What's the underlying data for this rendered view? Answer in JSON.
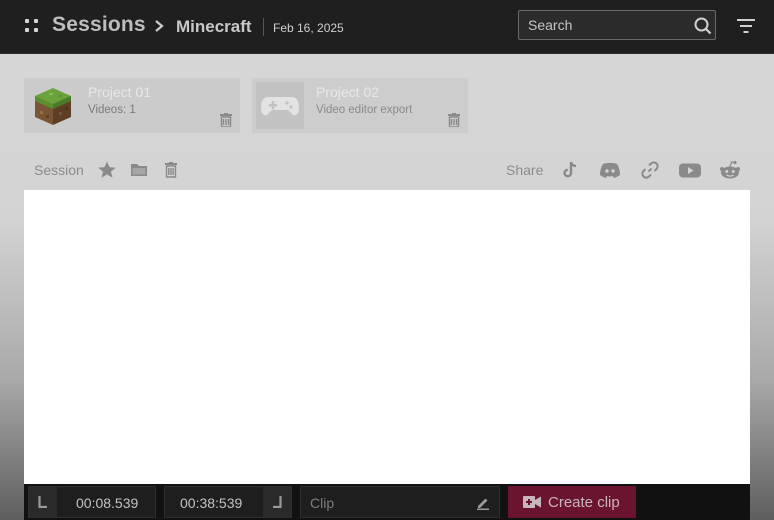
{
  "header": {
    "title": "Sessions",
    "breadcrumb_sep": "›",
    "game": "Minecraft",
    "date": "Feb 16, 2025",
    "search_placeholder": "Search",
    "icons": {
      "grip": "apps-grip-icon",
      "search": "search-icon",
      "filter": "filter-icon"
    }
  },
  "projects": [
    {
      "title": "Project 01",
      "subtitle": "Videos: 1",
      "thumb_icon": "minecraft-grass-block-icon",
      "delete_icon": "trash-icon"
    },
    {
      "title": "Project 02",
      "subtitle": "Video editor export",
      "thumb_icon": "gamepad-icon",
      "delete_icon": "trash-icon"
    }
  ],
  "session_toolbar": {
    "label": "Session",
    "icons": [
      "star-icon",
      "folder-icon",
      "trash-icon"
    ],
    "share_label": "Share",
    "share_icons": [
      "tiktok-icon",
      "discord-icon",
      "link-icon",
      "youtube-icon",
      "reddit-icon"
    ]
  },
  "player": {
    "background": "#ffffff"
  },
  "controls": {
    "start_time": "00:08.539",
    "end_time": "00:38:539",
    "clip_placeholder": "Clip",
    "create_label": "Create clip",
    "accent": "#6b1430",
    "icons": {
      "start_marker": "trim-start-icon",
      "end_marker": "trim-end-icon",
      "edit": "pencil-icon",
      "create": "video-camera-icon"
    }
  }
}
